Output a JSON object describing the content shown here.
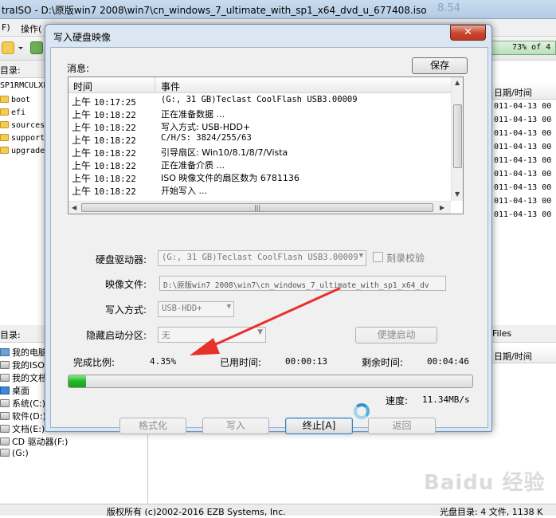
{
  "background_window": {
    "title": "traISO - D:\\原版win7 2008\\win7\\cn_windows_7_ultimate_with_sp1_x64_dvd_u_677408.iso",
    "menu_first": "F)",
    "menu_second": "操作(",
    "dir_label": "目录:",
    "capacity_text": "73% of 4",
    "iso_root": "SP1RMCULXF",
    "folders": [
      "boot",
      "efi",
      "sources",
      "support",
      "upgrade"
    ],
    "col_date_header": "日期/时间",
    "dates": [
      "011-04-13 00",
      "011-04-13 00",
      "011-04-13 00",
      "011-04-13 00",
      "011-04-13 00",
      "011-04-13 00",
      "011-04-13 00",
      "011-04-13 00",
      "011-04-13 00",
      "011-04-13 00"
    ],
    "bottom_left_header": "目录:",
    "bottom_right_header": "Files",
    "bottom_right_col": "日期/时间",
    "local_tree": [
      {
        "icon": "pc",
        "label": "我的电脑"
      },
      {
        "icon": "drive",
        "label": "我的ISO"
      },
      {
        "icon": "drive",
        "label": "我的文档"
      },
      {
        "icon": "desktop",
        "label": "桌面"
      },
      {
        "icon": "drive",
        "label": "系统(C:)"
      },
      {
        "icon": "drive",
        "label": "软件(D:)"
      },
      {
        "icon": "drive",
        "label": "文档(E:)"
      },
      {
        "icon": "drive",
        "label": "CD 驱动器(F:)"
      },
      {
        "icon": "drive",
        "label": "(G:)"
      }
    ],
    "status_copyright": "版权所有 (c)2002-2016 EZB Systems, Inc.",
    "status_right": "光盘目录: 4 文件, 1138 K",
    "watermark": "Baidu 经验"
  },
  "dialog": {
    "title": "写入硬盘映像",
    "close_label": "✕",
    "messages_label": "消息:",
    "save_label": "保存",
    "log_columns": {
      "time": "时间",
      "event": "事件"
    },
    "log": [
      {
        "ampm": "上午",
        "clock": "10:17:25",
        "event": "(G:, 31 GB)Teclast CoolFlash USB3.00009",
        "mono": true
      },
      {
        "ampm": "上午",
        "clock": "10:18:22",
        "event": "正在准备数据 ...",
        "mono": false
      },
      {
        "ampm": "上午",
        "clock": "10:18:22",
        "event": "写入方式: USB-HDD+",
        "mono": false
      },
      {
        "ampm": "上午",
        "clock": "10:18:22",
        "event": "C/H/S: 3824/255/63",
        "mono": true
      },
      {
        "ampm": "上午",
        "clock": "10:18:22",
        "event": "引导扇区: Win10/8.1/8/7/Vista",
        "mono": false
      },
      {
        "ampm": "上午",
        "clock": "10:18:22",
        "event": "正在准备介质 ...",
        "mono": false
      },
      {
        "ampm": "上午",
        "clock": "10:18:22",
        "event": "ISO 映像文件的扇区数为 6781136",
        "mono": false
      },
      {
        "ampm": "上午",
        "clock": "10:18:22",
        "event": "开始写入 ...",
        "mono": false
      }
    ],
    "disk_drive_label": "硬盘驱动器:",
    "disk_drive_value": "(G:, 31 GB)Teclast CoolFlash USB3.00009",
    "verify_label": "刻录校验",
    "verify_checked": false,
    "image_file_label": "映像文件:",
    "image_file_value": "D:\\原版win7 2008\\win7\\cn_windows_7_ultimate_with_sp1_x64_dv",
    "write_method_label": "写入方式:",
    "write_method_value": "USB-HDD+",
    "hidden_partition_label": "隐藏启动分区:",
    "hidden_partition_value": "无",
    "quick_boot_label": "便捷启动",
    "completed_label": "完成比例:",
    "completed_value": "4.35%",
    "progress_fraction": 0.0435,
    "elapsed_label": "已用时间:",
    "elapsed_value": "00:00:13",
    "remaining_label": "剩余时间:",
    "remaining_value": "00:04:46",
    "speed_label": "速度:",
    "speed_value": "11.34MB/s",
    "buttons": {
      "format": "格式化",
      "write": "写入",
      "stop": "终止[A]",
      "back": "返回"
    }
  },
  "colors": {
    "progress": "#23b52a",
    "annotation_arrow": "#e8302a",
    "close_button": "#c7452e"
  }
}
